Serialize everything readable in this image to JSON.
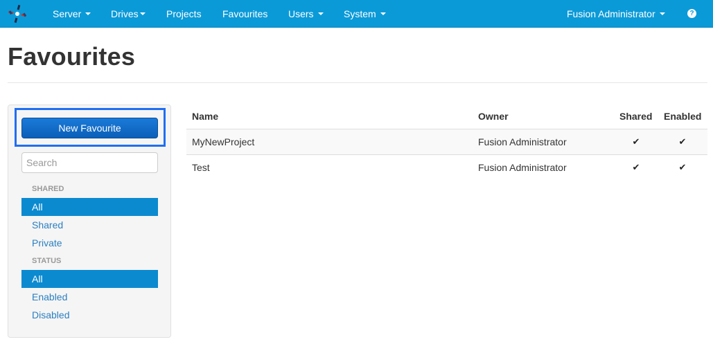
{
  "navbar": {
    "items": [
      {
        "label": "Server",
        "dropdown": true
      },
      {
        "label": "Drives",
        "dropdown": true
      },
      {
        "label": "Projects",
        "dropdown": false
      },
      {
        "label": "Favourites",
        "dropdown": false
      },
      {
        "label": "Users",
        "dropdown": true
      },
      {
        "label": "System",
        "dropdown": true
      }
    ],
    "user_menu": "Fusion Administrator",
    "help_glyph": "?"
  },
  "page": {
    "title": "Favourites"
  },
  "sidebar": {
    "new_button": "New Favourite",
    "search_placeholder": "Search",
    "shared_header": "SHARED",
    "shared_items": [
      "All",
      "Shared",
      "Private"
    ],
    "shared_selected": "All",
    "status_header": "STATUS",
    "status_items": [
      "All",
      "Enabled",
      "Disabled"
    ],
    "status_selected": "All"
  },
  "table": {
    "headers": {
      "name": "Name",
      "owner": "Owner",
      "shared": "Shared",
      "enabled": "Enabled"
    },
    "rows": [
      {
        "name": "MyNewProject",
        "owner": "Fusion Administrator",
        "shared": "✔",
        "enabled": "✔"
      },
      {
        "name": "Test",
        "owner": "Fusion Administrator",
        "shared": "✔",
        "enabled": "✔"
      }
    ]
  },
  "colors": {
    "navbar": "#0b9ad8",
    "primary_button": "#0b5fb8",
    "active_item": "#0b8ad0",
    "link": "#2a7fc1",
    "highlight_outline": "#1f6ef2"
  }
}
